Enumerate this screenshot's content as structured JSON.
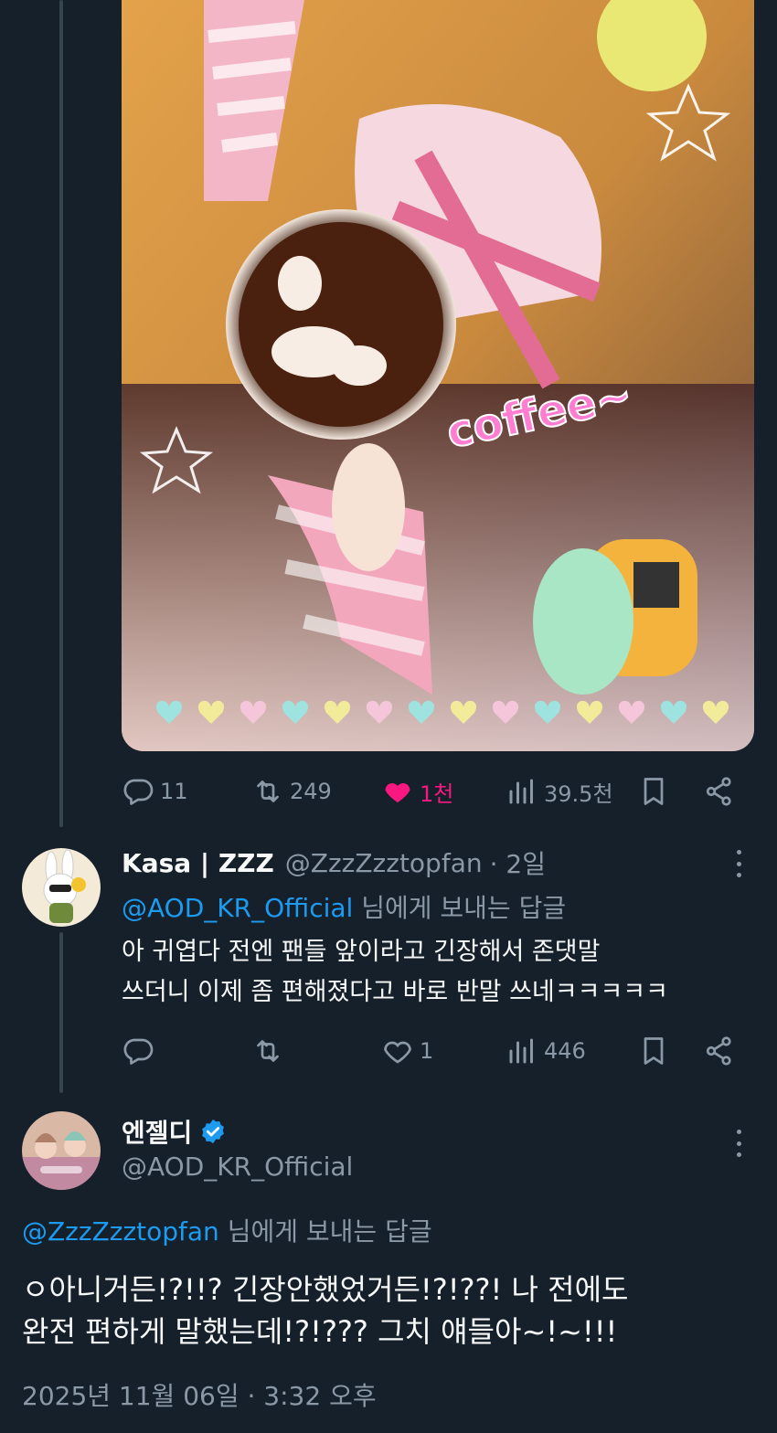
{
  "colors": {
    "background": "#15202b",
    "text_primary": "#f7f9f9",
    "text_secondary": "#8b98a5",
    "accent": "#1d9bf0",
    "like": "#f91880"
  },
  "media": {
    "overlay_text": "coffee~"
  },
  "original_tweet_actions": {
    "replies": "11",
    "retweets": "249",
    "likes": "1천",
    "views": "39.5천"
  },
  "reply_tweet": {
    "display_name": "Kasa | ZZZ",
    "handle": "@ZzzZzztopfan",
    "time": "· 2일",
    "reply_to_handle": "@AOD_KR_Official",
    "reply_to_suffix": "님에게 보내는 답글",
    "text_line1": "아 귀엽다 전엔 팬들 앞이라고 긴장해서 존댓말",
    "text_line2": "쓰더니 이제 좀 편해졌다고 바로 반말 쓰네ㅋㅋㅋㅋㅋ",
    "actions": {
      "replies": "",
      "retweets": "",
      "likes": "1",
      "views": "446"
    }
  },
  "main_tweet": {
    "display_name": "엔젤디",
    "handle": "@AOD_KR_Official",
    "reply_to_handle": "@ZzzZzztopfan",
    "reply_to_suffix": "님에게 보내는 답글",
    "text_line1": "ㅇ아니거든!?!!? 긴장안했었거든!?!??! 나 전에도",
    "text_line2": "완전 편하게 말했는데!?!??? 그치 얘들아~!~!!!",
    "timestamp": "2025년 11월 06일 · 3:32 오후"
  }
}
